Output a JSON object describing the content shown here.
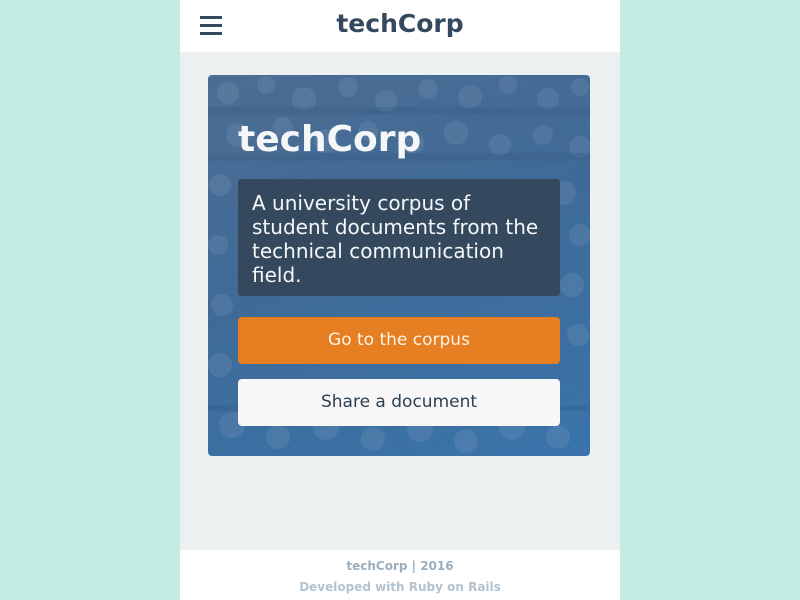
{
  "header": {
    "brand": "techCorp",
    "menu_icon": "hamburger-menu-icon"
  },
  "hero": {
    "title": "techCorp",
    "tagline": "A university corpus of student documents from the technical communication field.",
    "primary_button": "Go to the corpus",
    "secondary_button": "Share a document"
  },
  "footer": {
    "line1": "techCorp | 2016",
    "line2": "Developed with Ruby on Rails"
  },
  "colors": {
    "page_background": "#c4ece3",
    "content_background": "#ecf0f1",
    "navy": "#34495e",
    "orange": "#e67e22",
    "hero_blue": "#3f6a97"
  }
}
